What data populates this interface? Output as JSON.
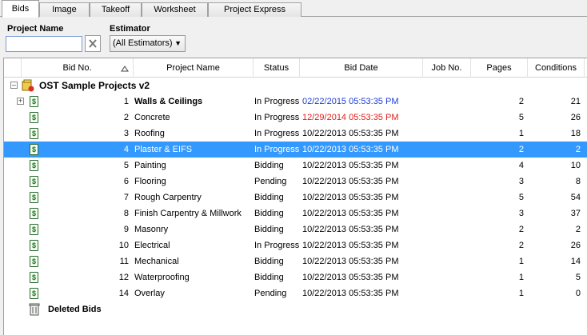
{
  "tabs": [
    "Bids",
    "Image",
    "Takeoff",
    "Worksheet",
    "Project Express"
  ],
  "filters": {
    "project_name_label": "Project Name",
    "project_name_value": "",
    "estimator_label": "Estimator",
    "estimator_value": "(All Estimators)"
  },
  "columns": {
    "bid_no": "Bid No.",
    "project_name": "Project Name",
    "status": "Status",
    "bid_date": "Bid Date",
    "job_no": "Job No.",
    "pages": "Pages",
    "conditions": "Conditions"
  },
  "group": {
    "name": "OST Sample Projects v2"
  },
  "rows": [
    {
      "bid": "1",
      "name": "Walls & Ceilings",
      "status": "In Progress",
      "date": "02/22/2015 05:53:35 PM",
      "pages": "2",
      "conditions": "21"
    },
    {
      "bid": "2",
      "name": "Concrete",
      "status": "In Progress",
      "date": "12/29/2014 05:53:35 PM",
      "pages": "5",
      "conditions": "26"
    },
    {
      "bid": "3",
      "name": "Roofing",
      "status": "In Progress",
      "date": "10/22/2013 05:53:35 PM",
      "pages": "1",
      "conditions": "18"
    },
    {
      "bid": "4",
      "name": "Plaster & EIFS",
      "status": "In Progress",
      "date": "10/22/2013 05:53:35 PM",
      "pages": "2",
      "conditions": "2"
    },
    {
      "bid": "5",
      "name": "Painting",
      "status": "Bidding",
      "date": "10/22/2013 05:53:35 PM",
      "pages": "4",
      "conditions": "10"
    },
    {
      "bid": "6",
      "name": "Flooring",
      "status": "Pending",
      "date": "10/22/2013 05:53:35 PM",
      "pages": "3",
      "conditions": "8"
    },
    {
      "bid": "7",
      "name": "Rough Carpentry",
      "status": "Bidding",
      "date": "10/22/2013 05:53:35 PM",
      "pages": "5",
      "conditions": "54"
    },
    {
      "bid": "8",
      "name": "Finish Carpentry & Millwork",
      "status": "Bidding",
      "date": "10/22/2013 05:53:35 PM",
      "pages": "3",
      "conditions": "37"
    },
    {
      "bid": "9",
      "name": "Masonry",
      "status": "Bidding",
      "date": "10/22/2013 05:53:35 PM",
      "pages": "2",
      "conditions": "2"
    },
    {
      "bid": "10",
      "name": "Electrical",
      "status": "In Progress",
      "date": "10/22/2013 05:53:35 PM",
      "pages": "2",
      "conditions": "26"
    },
    {
      "bid": "11",
      "name": "Mechanical",
      "status": "Bidding",
      "date": "10/22/2013 05:53:35 PM",
      "pages": "1",
      "conditions": "14"
    },
    {
      "bid": "12",
      "name": "Waterproofing",
      "status": "Bidding",
      "date": "10/22/2013 05:53:35 PM",
      "pages": "1",
      "conditions": "5"
    },
    {
      "bid": "14",
      "name": "Overlay",
      "status": "Pending",
      "date": "10/22/2013 05:53:35 PM",
      "pages": "1",
      "conditions": "0"
    }
  ],
  "deleted_bids": "Deleted Bids",
  "colors": {
    "selection": "#3399ff",
    "date_future": "#1a3fd6",
    "date_overdue": "#e0201a"
  }
}
